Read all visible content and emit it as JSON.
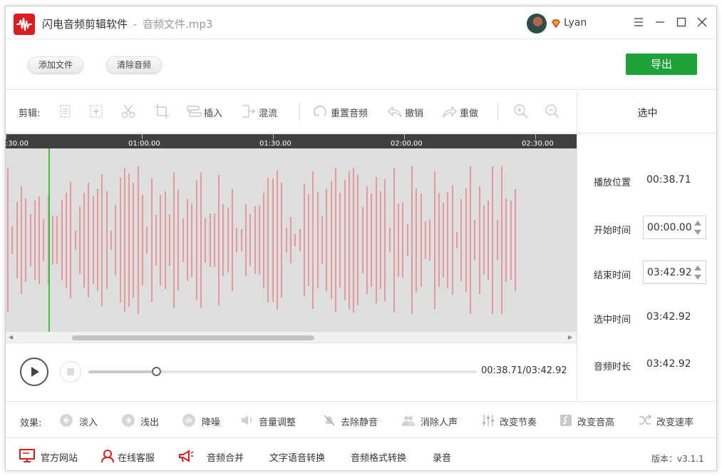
{
  "app": {
    "title": "闪电音频剪辑软件",
    "separator": "-",
    "file_name": "音频文件.mp3",
    "username": "Lyan"
  },
  "actions": {
    "add_file": "添加文件",
    "clear_audio": "清除音频",
    "export": "导出"
  },
  "toolbar": {
    "label": "剪辑:",
    "insert": "插入",
    "mix": "混流",
    "reset_audio": "重置音频",
    "undo": "撤销",
    "redo": "重做"
  },
  "side_panel": {
    "header": "选中",
    "play_position_label": "播放位置",
    "play_position": "00:38.71",
    "start_time_label": "开始时间",
    "start_time": "00:00.00",
    "end_time_label": "结束时间",
    "end_time": "03:42.92",
    "selected_time_label": "选中时间",
    "selected_time": "03:42.92",
    "duration_label": "音频时长",
    "duration": "03:42.92"
  },
  "timeline": {
    "ticks": [
      ":30.00",
      "01:00.00",
      "01:30.00",
      "02:00.00",
      "02:30.00"
    ],
    "playhead_position": "00:38.71"
  },
  "transport": {
    "time_readout": "00:38.71/03:42.92",
    "progress_fraction": 0.174
  },
  "effects": {
    "label": "效果:",
    "fade_in": "淡入",
    "fade_out": "浅出",
    "denoise": "降噪",
    "volume": "音量调整",
    "remove_silence": "去除静音",
    "remove_vocals": "消除人声",
    "change_tempo": "改变节奏",
    "change_pitch": "改变音高",
    "change_speed": "改变速率"
  },
  "footer": {
    "website": "官方网站",
    "support": "在线客服",
    "merge_audio": "音频合并",
    "tts": "文字语音转换",
    "format_convert": "音频格式转换",
    "record": "录音",
    "version": "版本：v3.1.1"
  },
  "colors": {
    "accent_green": "#1ea33a",
    "waveform": "#e39a9a",
    "playhead": "#39c43b",
    "logo_red": "#d81e1e"
  }
}
